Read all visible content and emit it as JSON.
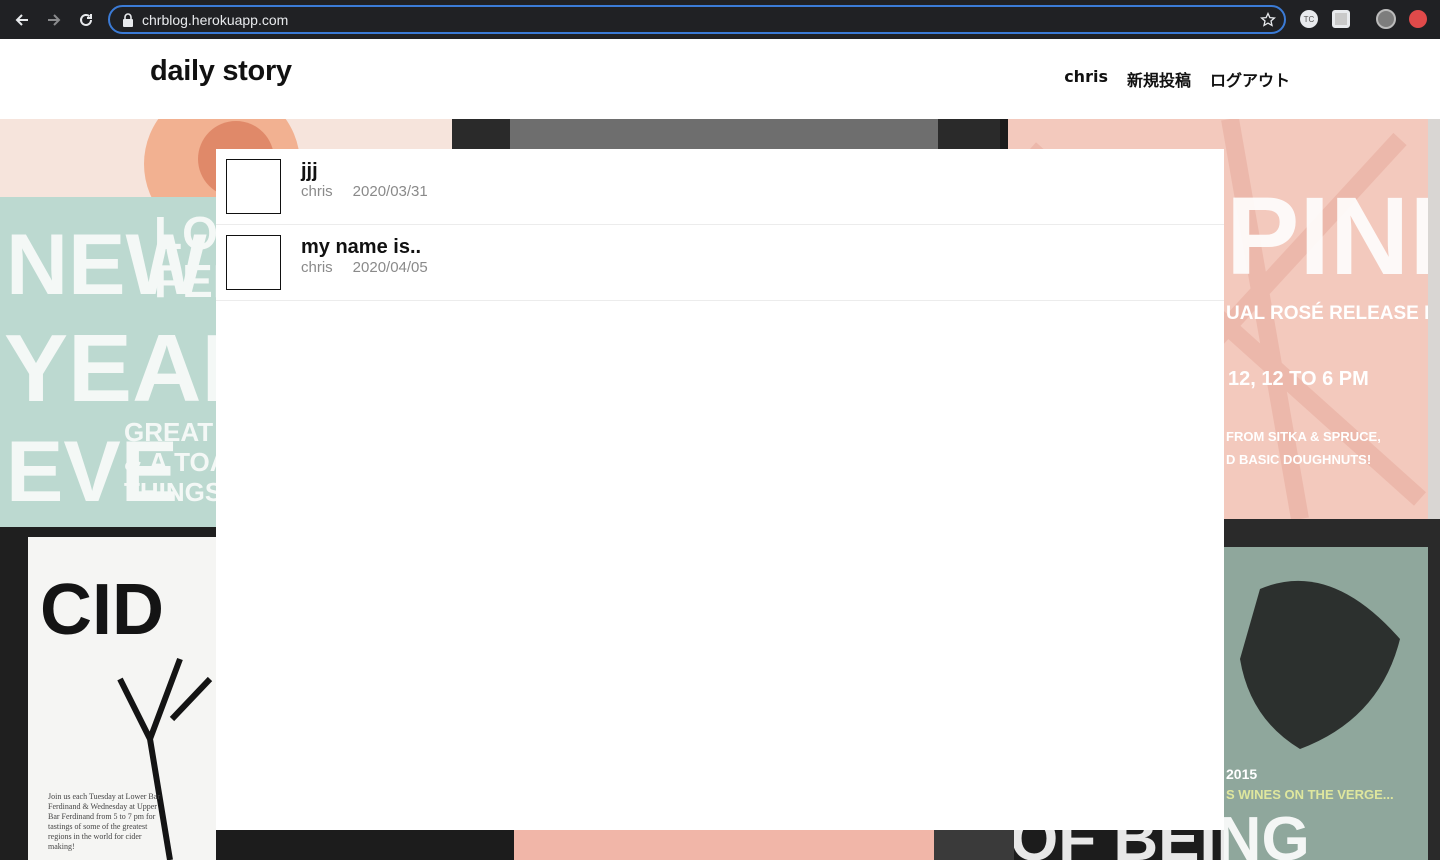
{
  "browser": {
    "url": "chrblog.herokuapp.com",
    "extension_label": "TC"
  },
  "site": {
    "logo": "daily story",
    "nav": [
      {
        "label": "chris"
      },
      {
        "label": "新規投稿"
      },
      {
        "label": "ログアウト"
      }
    ]
  },
  "background": {
    "poster_texts": [
      "NEW",
      "LOW",
      "FER",
      "YEARS",
      "EVE",
      "GREAT MU",
      "& A TOAST",
      "THINGS TO",
      "CID",
      "PINK",
      "UAL ROSÉ RELEASE PARTY",
      "12, 12 TO 6 PM",
      "FROM SITKA & SPRUCE,",
      "D BASIC DOUGHNUTS!",
      "2015",
      "S WINES ON THE VERGE...",
      "OF BEING",
      "Join us each Tuesday at Lower Bar",
      "Ferdinand & Wednesday at Upper",
      "Bar Ferdinand from 5 to 7 pm for",
      "tastings of some of the greatest",
      "regions in the world for cider",
      "making!"
    ]
  },
  "posts": [
    {
      "title": "jjj",
      "author": "chris",
      "date": "2020/03/31"
    },
    {
      "title": "my name is..",
      "author": "chris",
      "date": "2020/04/05"
    }
  ],
  "colors": {
    "chrome_bg": "#202124",
    "omnibox_border": "#3b7bd6",
    "meta_gray": "#8a8a8a"
  }
}
